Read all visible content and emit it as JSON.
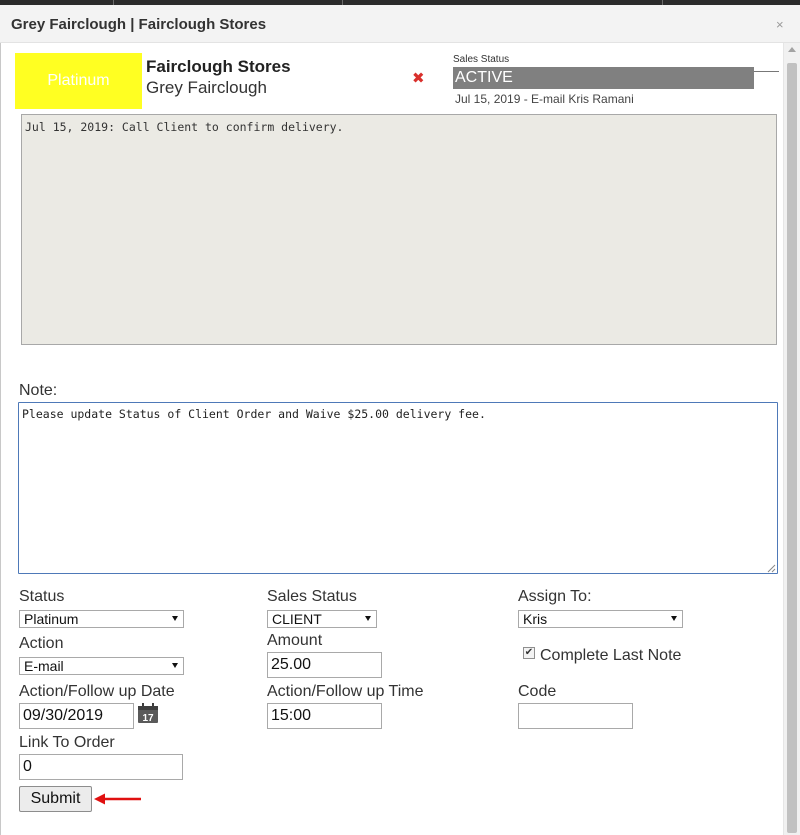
{
  "dialog": {
    "title": "Grey Fairclough | Fairclough Stores",
    "close_glyph": "×"
  },
  "header": {
    "badge_label": "Platinum",
    "badge_color": "#ffff22",
    "company": "Fairclough Stores",
    "contact": "Grey Fairclough",
    "delete_glyph": "✖",
    "sales_status_label": "Sales Status",
    "sales_status_value": "ACTIVE",
    "last_action": "Jul 15, 2019 - E-mail Kris Ramani"
  },
  "history": {
    "text": "Jul 15, 2019: Call Client to confirm delivery."
  },
  "note": {
    "label": "Note:",
    "value": "Please update Status of Client Order and Waive $25.00 delivery fee."
  },
  "form": {
    "status": {
      "label": "Status",
      "value": "Platinum"
    },
    "sales_status": {
      "label": "Sales Status",
      "value": "CLIENT"
    },
    "assign_to": {
      "label": "Assign To:",
      "value": "Kris"
    },
    "action": {
      "label": "Action",
      "value": "E-mail"
    },
    "amount": {
      "label": "Amount",
      "value": "25.00"
    },
    "complete_last_note": {
      "label": "Complete Last Note",
      "checked": true,
      "check_glyph": "✔"
    },
    "followup_date": {
      "label": "Action/Follow up Date",
      "value": "09/30/2019",
      "calendar_day": "17"
    },
    "followup_time": {
      "label": "Action/Follow up Time",
      "value": "15:00"
    },
    "code": {
      "label": "Code",
      "value": ""
    },
    "link_to_order": {
      "label": "Link To Order",
      "value": "0"
    },
    "submit_label": "Submit"
  },
  "colors": {
    "sales_status_bar": "#808080",
    "annotation_arrow": "#e01010",
    "note_border": "#4e79b8"
  }
}
